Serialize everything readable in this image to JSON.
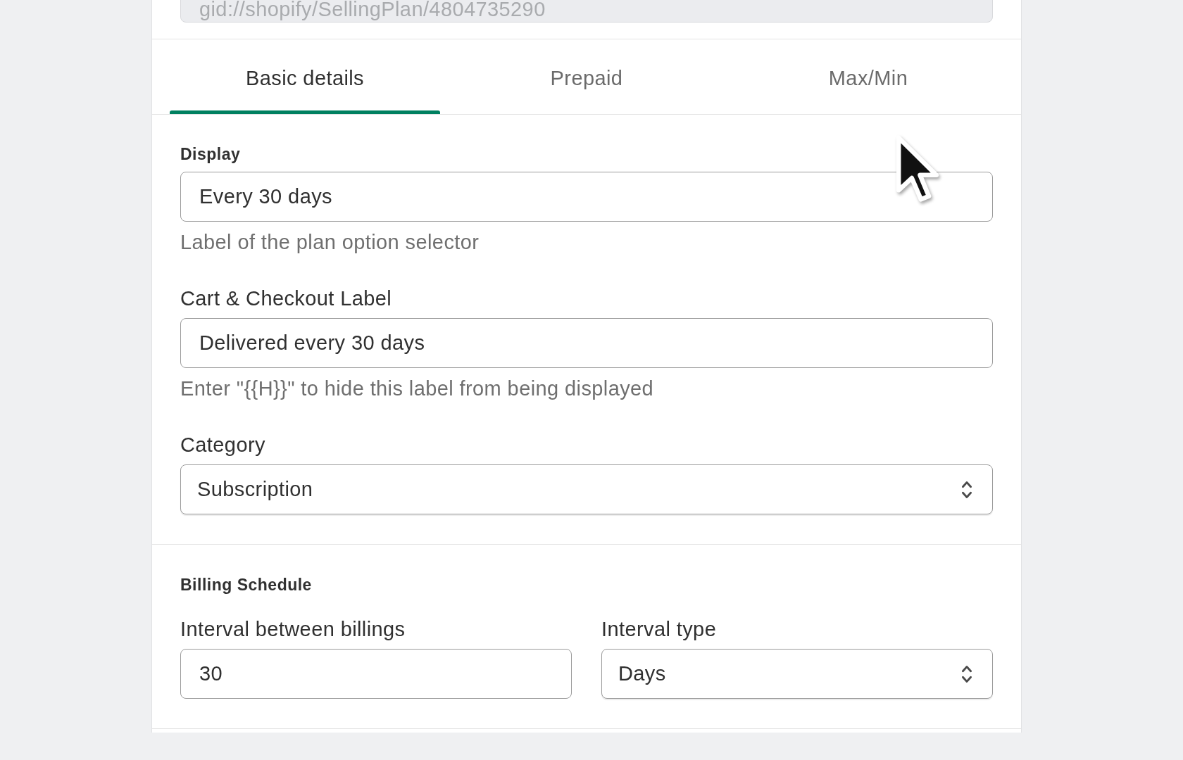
{
  "id_field": {
    "value": "gid://shopify/SellingPlan/4804735290",
    "disabled": true
  },
  "tabs": [
    {
      "label": "Basic details",
      "selected": true
    },
    {
      "label": "Prepaid",
      "selected": false
    },
    {
      "label": "Max/Min",
      "selected": false
    }
  ],
  "sections": [
    {
      "title": "Display",
      "fields": [
        {
          "kind": "text",
          "value": "Every 30 days",
          "help": "Label of the plan option selector"
        },
        {
          "kind": "text",
          "label": "Cart & Checkout Label",
          "value": "Delivered every 30 days",
          "help": "Enter \"{{H}}\" to hide this label from being displayed"
        },
        {
          "kind": "select",
          "label": "Category",
          "value": "Subscription"
        }
      ]
    },
    {
      "title": "Billing Schedule",
      "columns": [
        {
          "kind": "text",
          "label": "Interval between billings",
          "value": "30"
        },
        {
          "kind": "select",
          "label": "Interval type",
          "value": "Days"
        }
      ]
    }
  ]
}
